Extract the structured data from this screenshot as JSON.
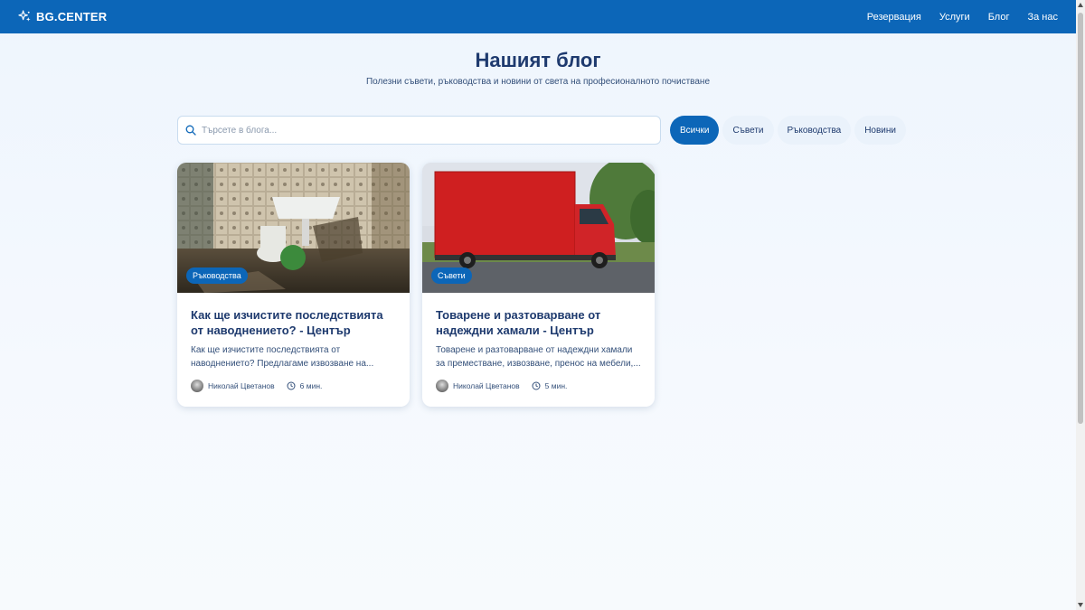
{
  "header": {
    "logo_text": "BG.CENTER",
    "nav": [
      "Резервация",
      "Услуги",
      "Блог",
      "За нас"
    ]
  },
  "hero": {
    "title": "Нашият блог",
    "subtitle": "Полезни съвети, ръководства и новини от света на професионалното почистване"
  },
  "search": {
    "placeholder": "Търсете в блога..."
  },
  "filters": [
    "Всички",
    "Съвети",
    "Ръководства",
    "Новини"
  ],
  "active_filter": "Всички",
  "posts": [
    {
      "category": "Ръководства",
      "title": "Как ще изчистите последствията от наводнението? - Център",
      "excerpt": "Как ще изчистите последствията от наводнението? Предлагаме извозване на...",
      "author": "Николай Цветанов",
      "read_time": "6 мин.",
      "image": "flooded-bathroom"
    },
    {
      "category": "Съвети",
      "title": "Товарене и разтоварване от надеждни хамали - Център",
      "excerpt": "Товарене и разтоварване от надеждни хамали за преместване, извозване, пренос на мебели,...",
      "author": "Николай Цветанов",
      "read_time": "5 мин.",
      "image": "red-truck"
    }
  ],
  "colors": {
    "primary": "#0c66b8",
    "heading": "#1e3a6e",
    "background": "#eef5fd"
  }
}
